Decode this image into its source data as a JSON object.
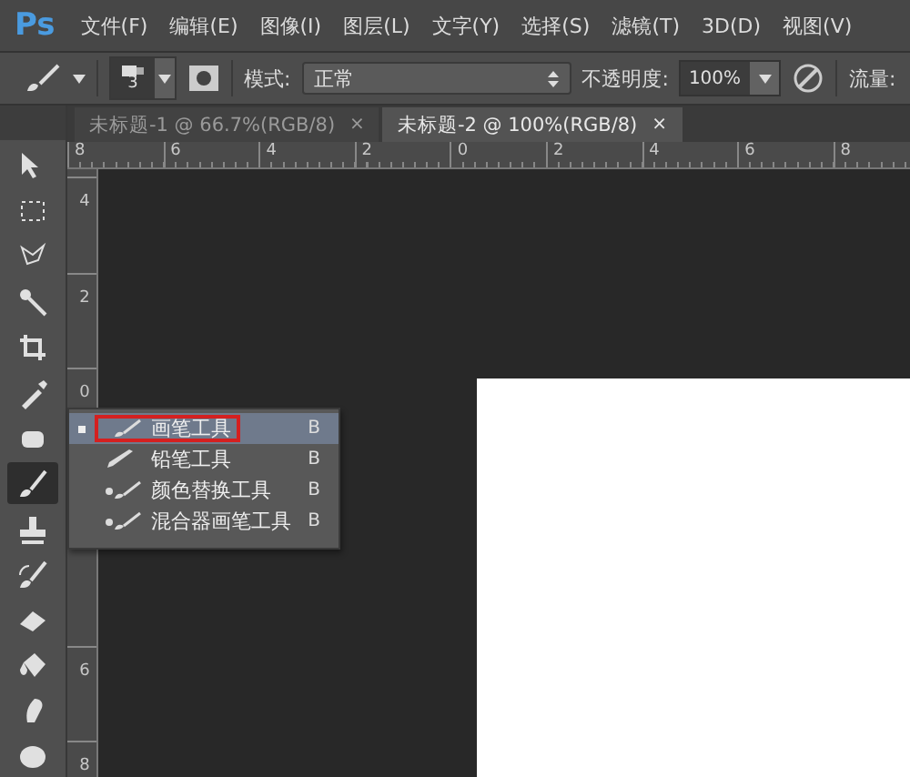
{
  "app_logo": "Ps",
  "menu": [
    "文件(F)",
    "编辑(E)",
    "图像(I)",
    "图层(L)",
    "文字(Y)",
    "选择(S)",
    "滤镜(T)",
    "3D(D)",
    "视图(V)"
  ],
  "options_bar": {
    "brush_size": "3",
    "mode_label": "模式:",
    "mode_value": "正常",
    "opacity_label": "不透明度:",
    "opacity_value": "100%",
    "flow_label": "流量:"
  },
  "tabs": [
    {
      "label": "未标题-1 @ 66.7%(RGB/8)",
      "close": "×",
      "selected": false
    },
    {
      "label": "未标题-2 @ 100%(RGB/8)",
      "close": "×",
      "selected": true
    }
  ],
  "top_ruler": [
    "8",
    "6",
    "4",
    "2",
    "0",
    "2",
    "4",
    "6",
    "8"
  ],
  "left_ruler": [
    "4",
    "2",
    "0",
    "6",
    "8"
  ],
  "tools": [
    {
      "kind": "move",
      "selected": false
    },
    {
      "kind": "marquee",
      "selected": false
    },
    {
      "kind": "lasso",
      "selected": false
    },
    {
      "kind": "wand",
      "selected": false
    },
    {
      "kind": "crop",
      "selected": false
    },
    {
      "kind": "eyedropper",
      "selected": false
    },
    {
      "kind": "healing",
      "selected": false
    },
    {
      "kind": "brush",
      "selected": true
    },
    {
      "kind": "stamp",
      "selected": false
    },
    {
      "kind": "history",
      "selected": false
    },
    {
      "kind": "eraser",
      "selected": false
    },
    {
      "kind": "bucket",
      "selected": false
    },
    {
      "kind": "smudge",
      "selected": false
    },
    {
      "kind": "sponge",
      "selected": false
    }
  ],
  "flyout": [
    {
      "label": "画笔工具",
      "shortcut": "B",
      "selected": true,
      "highlighted": true
    },
    {
      "label": "铅笔工具",
      "shortcut": "B",
      "selected": false,
      "highlighted": false
    },
    {
      "label": "颜色替换工具",
      "shortcut": "B",
      "selected": false,
      "highlighted": false
    },
    {
      "label": "混合器画笔工具",
      "shortcut": "B",
      "selected": false,
      "highlighted": false
    }
  ]
}
